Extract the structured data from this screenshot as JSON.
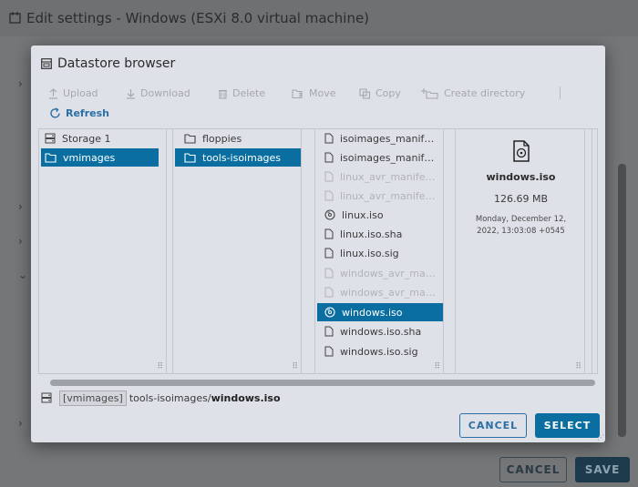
{
  "background": {
    "window_title": "Edit settings - Windows (ESXi 8.0 virtual machine)",
    "cancel_label": "CANCEL",
    "save_label": "SAVE"
  },
  "dialog": {
    "title": "Datastore browser",
    "toolbar": {
      "upload": "Upload",
      "download": "Download",
      "delete": "Delete",
      "move": "Move",
      "copy": "Copy",
      "create_directory": "Create directory",
      "refresh": "Refresh"
    },
    "columns": {
      "datastores": [
        {
          "label": "Storage 1",
          "icon": "datastore-icon",
          "selected": false
        },
        {
          "label": "vmimages",
          "icon": "folder-icon",
          "selected": true
        }
      ],
      "folders": [
        {
          "label": "floppies",
          "icon": "folder-icon",
          "selected": false
        },
        {
          "label": "tools-isoimages",
          "icon": "folder-icon",
          "selected": true
        }
      ],
      "files": [
        {
          "label": "isoimages_manif…",
          "icon": "file-icon",
          "state": "normal"
        },
        {
          "label": "isoimages_manif…",
          "icon": "file-icon",
          "state": "normal"
        },
        {
          "label": "linux_avr_manife…",
          "icon": "file-icon",
          "state": "dim"
        },
        {
          "label": "linux_avr_manife…",
          "icon": "file-icon",
          "state": "dim"
        },
        {
          "label": "linux.iso",
          "icon": "disc-icon",
          "state": "normal"
        },
        {
          "label": "linux.iso.sha",
          "icon": "file-icon",
          "state": "normal"
        },
        {
          "label": "linux.iso.sig",
          "icon": "file-icon",
          "state": "normal"
        },
        {
          "label": "windows_avr_ma…",
          "icon": "file-icon",
          "state": "dim"
        },
        {
          "label": "windows_avr_ma…",
          "icon": "file-icon",
          "state": "dim"
        },
        {
          "label": "windows.iso",
          "icon": "disc-icon",
          "state": "selected"
        },
        {
          "label": "windows.iso.sha",
          "icon": "file-icon",
          "state": "normal"
        },
        {
          "label": "windows.iso.sig",
          "icon": "file-icon",
          "state": "normal"
        }
      ]
    },
    "details": {
      "name": "windows.iso",
      "size": "126.69 MB",
      "modified": "Monday, December 12, 2022, 13:03:08 +0545"
    },
    "path": {
      "datastore": "[vmimages]",
      "folder": "tools-isoimages/",
      "file": "windows.iso"
    },
    "buttons": {
      "cancel": "CANCEL",
      "select": "SELECT"
    }
  },
  "colors": {
    "accent": "#0a6fa0",
    "link": "#2a6fa6",
    "dialog_bg": "#dfe1e8"
  }
}
